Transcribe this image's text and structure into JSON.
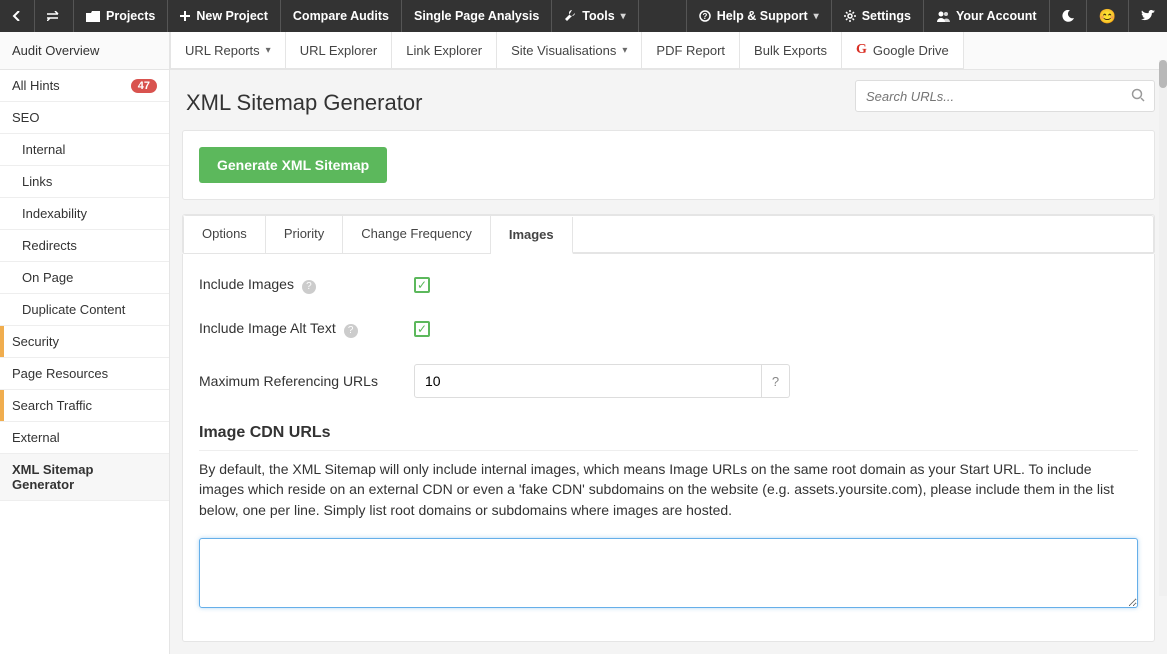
{
  "topnav": {
    "projects": "Projects",
    "new_project": "New Project",
    "compare": "Compare Audits",
    "single_page": "Single Page Analysis",
    "tools": "Tools",
    "help": "Help & Support",
    "settings": "Settings",
    "account": "Your Account"
  },
  "secondnav": {
    "audit_overview": "Audit Overview",
    "tabs": [
      "URL Reports",
      "URL Explorer",
      "Link Explorer",
      "Site Visualisations",
      "PDF Report",
      "Bulk Exports",
      "Google Drive"
    ]
  },
  "sidebar": {
    "all_hints": "All Hints",
    "badge": "47",
    "seo": "SEO",
    "internal": "Internal",
    "links": "Links",
    "indexability": "Indexability",
    "redirects": "Redirects",
    "on_page": "On Page",
    "dup": "Duplicate Content",
    "security": "Security",
    "page_res": "Page Resources",
    "traffic": "Search Traffic",
    "external": "External",
    "xml": "XML Sitemap Generator"
  },
  "page": {
    "title": "XML Sitemap Generator",
    "search_ph": "Search URLs...",
    "generate_btn": "Generate XML Sitemap"
  },
  "subtabs": [
    "Options",
    "Priority",
    "Change Frequency",
    "Images"
  ],
  "form": {
    "include_images": "Include Images",
    "include_alt": "Include Image Alt Text",
    "max_ref": "Maximum Referencing URLs",
    "max_ref_val": "10",
    "cdn_heading": "Image CDN URLs",
    "cdn_text": "By default, the XML Sitemap will only include internal images, which means Image URLs on the same root domain as your Start URL. To include images which reside on an external CDN or even a 'fake CDN' subdomains on the website (e.g. assets.yoursite.com), please include them in the list below, one per line. Simply list root domains or subdomains where images are hosted."
  }
}
